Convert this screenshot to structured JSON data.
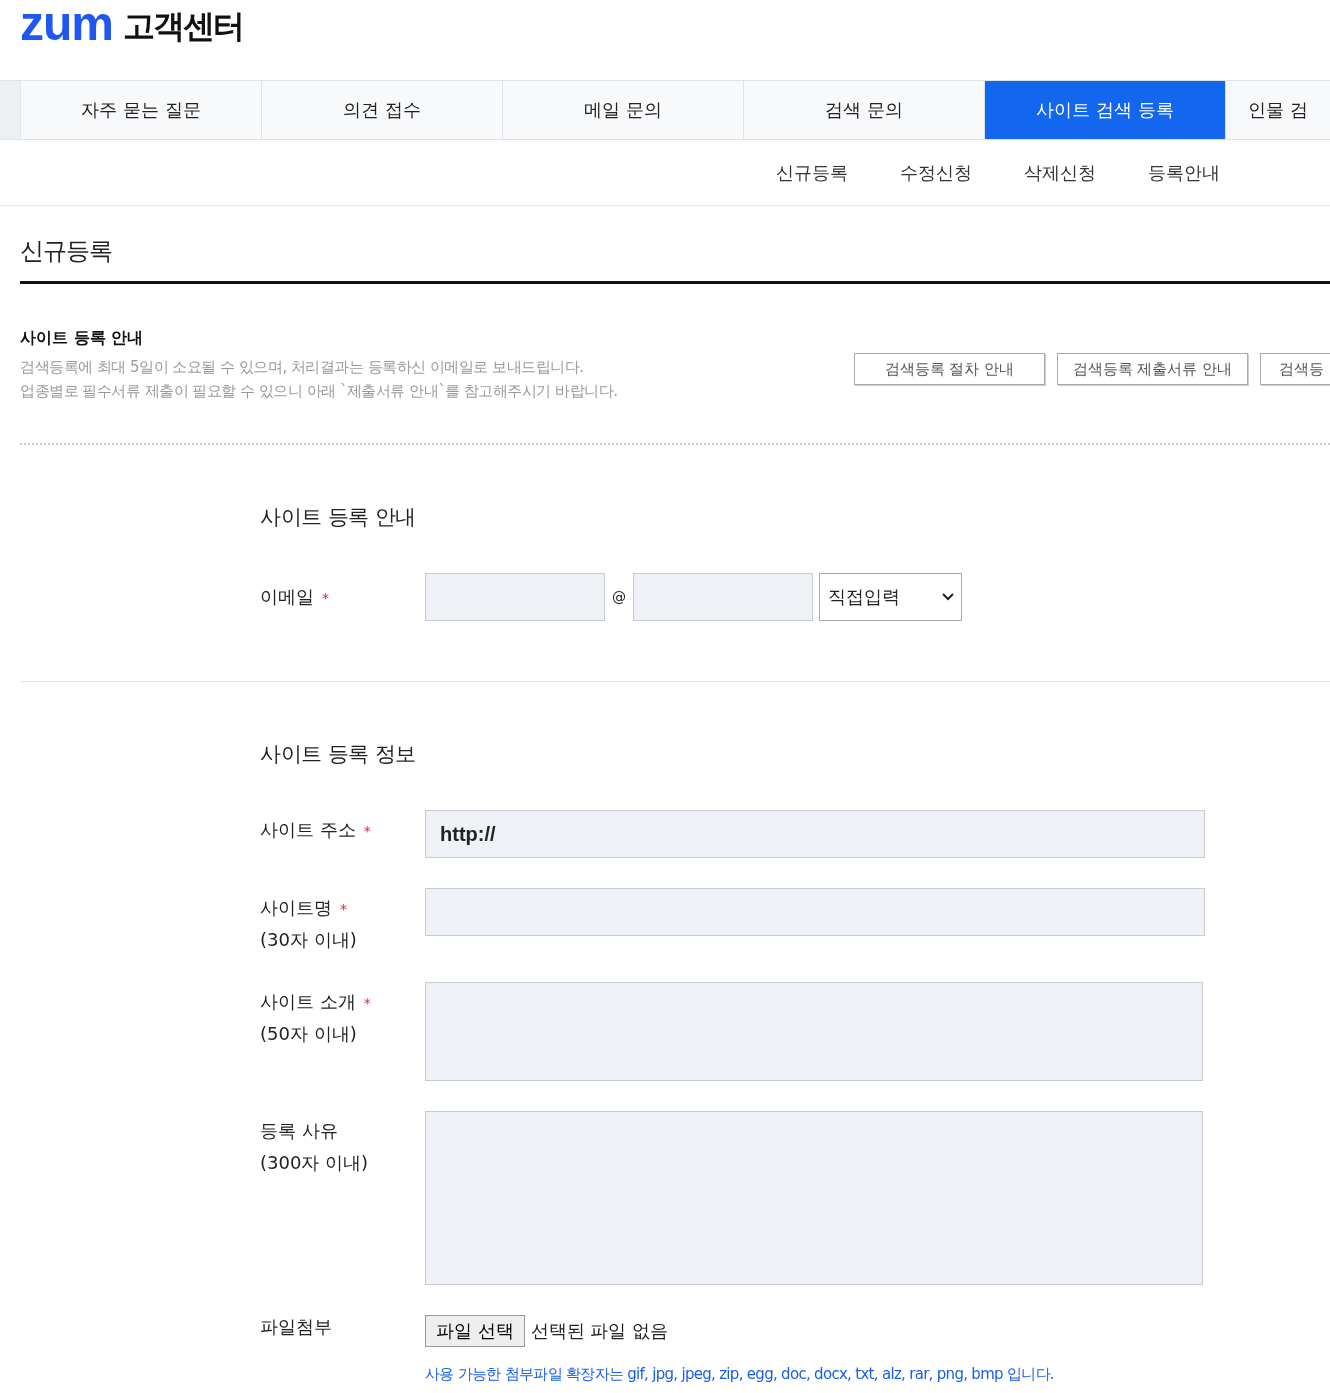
{
  "logo": {
    "brand": "zum",
    "title": "고객센터"
  },
  "tabs": [
    {
      "label": "자주 묻는 질문",
      "selected": false
    },
    {
      "label": "의견 접수",
      "selected": false
    },
    {
      "label": "메일 문의",
      "selected": false
    },
    {
      "label": "검색 문의",
      "selected": false
    },
    {
      "label": "사이트 검색 등록",
      "selected": true
    },
    {
      "label": "인물 검",
      "selected": false
    }
  ],
  "subnav": [
    {
      "label": "신규등록"
    },
    {
      "label": "수정신청"
    },
    {
      "label": "삭제신청"
    },
    {
      "label": "등록안내"
    }
  ],
  "page_title": "신규등록",
  "notice": {
    "title": "사이트 등록 안내",
    "lines": [
      "검색등록에 최대 5일이 소요될 수 있으며, 처리결과는 등록하신 이메일로 보내드립니다.",
      "업종별로 필수서류 제출이 필요할 수 있으니 아래 `제출서류 안내`를 참고해주시기 바랍니다."
    ],
    "buttons": [
      "검색등록 절차 안내",
      "검색등록 제출서류 안내",
      "검색등"
    ]
  },
  "email_section": {
    "title": "사이트 등록 안내",
    "label": "이메일",
    "mark": "*",
    "at": "@",
    "domain_select": "직접입력"
  },
  "info_section": {
    "title": "사이트 등록 정보",
    "rows": [
      {
        "kind": "input",
        "label": "사이트 주소",
        "mark": "*",
        "value": "http://"
      },
      {
        "kind": "input",
        "label": "사이트명",
        "mark": "*",
        "hint": "(30자 이내)"
      },
      {
        "kind": "textarea",
        "label": "사이트 소개",
        "mark": "*",
        "hint": "(50자 이내)"
      },
      {
        "kind": "textarea_tall",
        "label": "등록 사유",
        "hint": "(300자 이내)"
      }
    ]
  },
  "file": {
    "label": "파일첨부",
    "button": "파일 선택",
    "status": "선택된 파일 없음",
    "note": "사용 가능한 첨부파일 확장자는 gif, jpg, jpeg, zip, egg, doc, docx, txt, alz, rar, png, bmp 입니다."
  }
}
